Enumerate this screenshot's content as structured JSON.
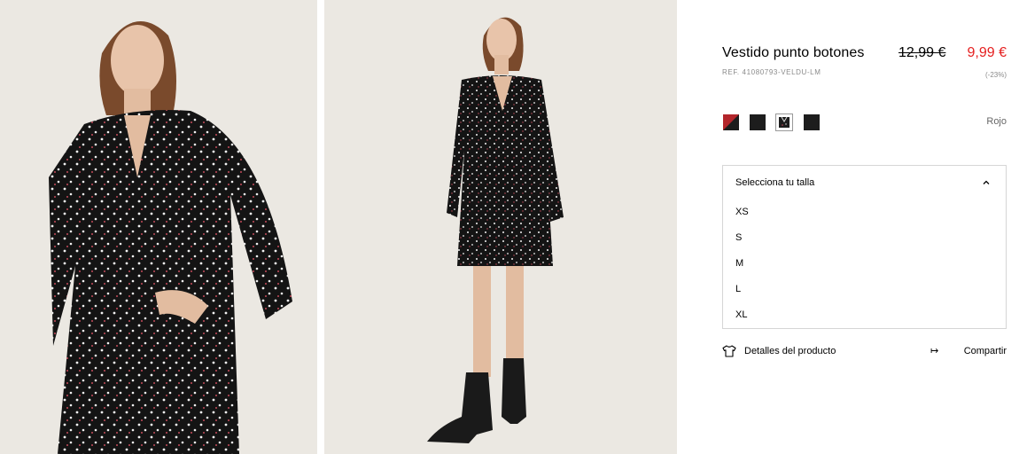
{
  "gallery": {
    "images": [
      {
        "icon": "model-front-closeup-photo"
      },
      {
        "icon": "model-full-body-photo"
      }
    ]
  },
  "product": {
    "title": "Vestido punto botones",
    "old_price": "12,99 €",
    "new_price": "9,99 €",
    "reference": "REF. 41080793-VELDU-LM",
    "discount": "(-23%)",
    "sale_color": "#e51f1f"
  },
  "colors": {
    "selected_name": "Rojo",
    "swatches": [
      {
        "icon": "red-black-swatch",
        "selected": false
      },
      {
        "icon": "black-swatch",
        "selected": false
      },
      {
        "icon": "black-print-swatch",
        "selected": true
      },
      {
        "icon": "black-swatch",
        "selected": false
      }
    ]
  },
  "sizes": {
    "label": "Selecciona tu talla",
    "expanded": true,
    "options": [
      "XS",
      "S",
      "M",
      "L",
      "XL"
    ]
  },
  "actions": {
    "details_label": "Detalles del producto",
    "details_icon": "tshirt-icon",
    "share_label": "Compartir",
    "share_icon": "share-icon"
  }
}
